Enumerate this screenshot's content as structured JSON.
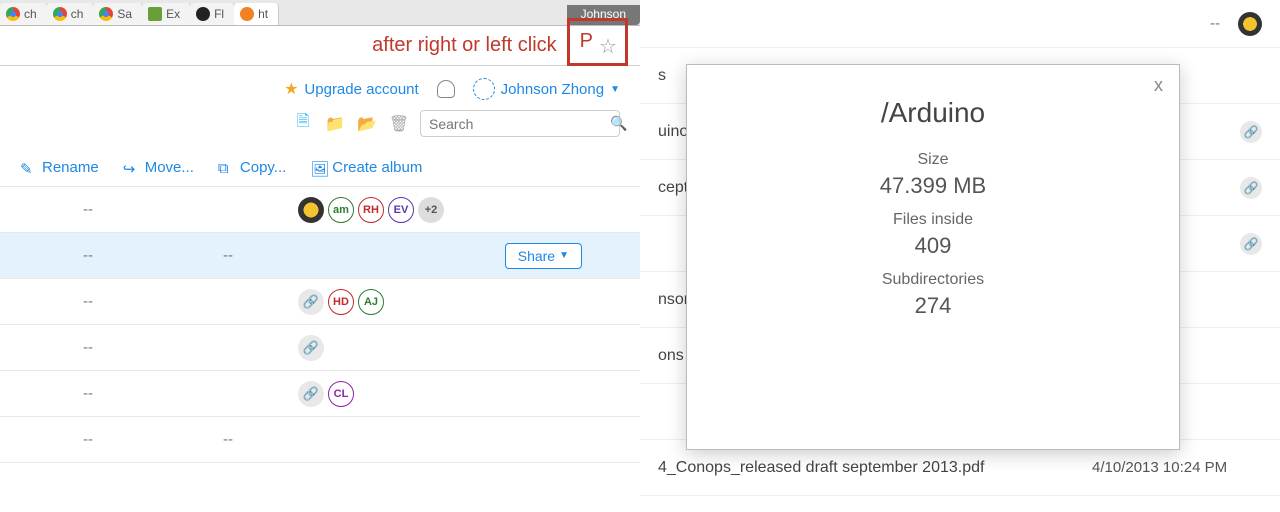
{
  "browser": {
    "tabs": [
      "ch",
      "ch",
      "Sa",
      "Ex",
      "Fl",
      "ht"
    ],
    "profile": "Johnson",
    "annotation": "after right or left click",
    "p_letter": "P"
  },
  "header": {
    "upgrade": "Upgrade account",
    "user": "Johnson Zhong"
  },
  "search": {
    "placeholder": "Search"
  },
  "actions": {
    "rename": "Rename",
    "move": "Move...",
    "copy": "Copy...",
    "album": "Create album"
  },
  "rows": [
    {
      "a": "--",
      "b": "",
      "badges": [
        {
          "t": "img"
        },
        {
          "t": "am",
          "l": "am"
        },
        {
          "t": "rh",
          "l": "RH"
        },
        {
          "t": "ev",
          "l": "EV"
        },
        {
          "t": "plus",
          "l": "+2"
        }
      ]
    },
    {
      "a": "--",
      "b": "--",
      "sel": true,
      "share": "Share"
    },
    {
      "a": "--",
      "b": "",
      "badges": [
        {
          "t": "link",
          "l": "🔗"
        },
        {
          "t": "hd",
          "l": "HD"
        },
        {
          "t": "aj",
          "l": "AJ"
        }
      ]
    },
    {
      "a": "--",
      "b": "",
      "badges": [
        {
          "t": "link",
          "l": "🔗"
        }
      ]
    },
    {
      "a": "--",
      "b": "",
      "badges": [
        {
          "t": "link",
          "l": "🔗"
        },
        {
          "t": "cl",
          "l": "CL"
        }
      ]
    },
    {
      "a": "--",
      "b": "--"
    }
  ],
  "rightTop": "--",
  "rightRows": [
    {
      "name": "s",
      "date": "--"
    },
    {
      "name": "uino",
      "date": "",
      "link": true
    },
    {
      "name": "ceptua",
      "date": "",
      "link": true
    },
    {
      "name": "",
      "date": "",
      "link": true
    },
    {
      "name": "nson",
      "date": "--"
    },
    {
      "name": "ons",
      "date": "--"
    },
    {
      "name": "",
      "date": "--"
    },
    {
      "name": "4_Conops_released draft september 2013.pdf",
      "date": "4/10/2013 10:24 PM"
    }
  ],
  "modal": {
    "title": "/Arduino",
    "size_k": "Size",
    "size_v": "47.399 MB",
    "files_k": "Files inside",
    "files_v": "409",
    "dirs_k": "Subdirectories",
    "dirs_v": "274",
    "close": "x"
  }
}
